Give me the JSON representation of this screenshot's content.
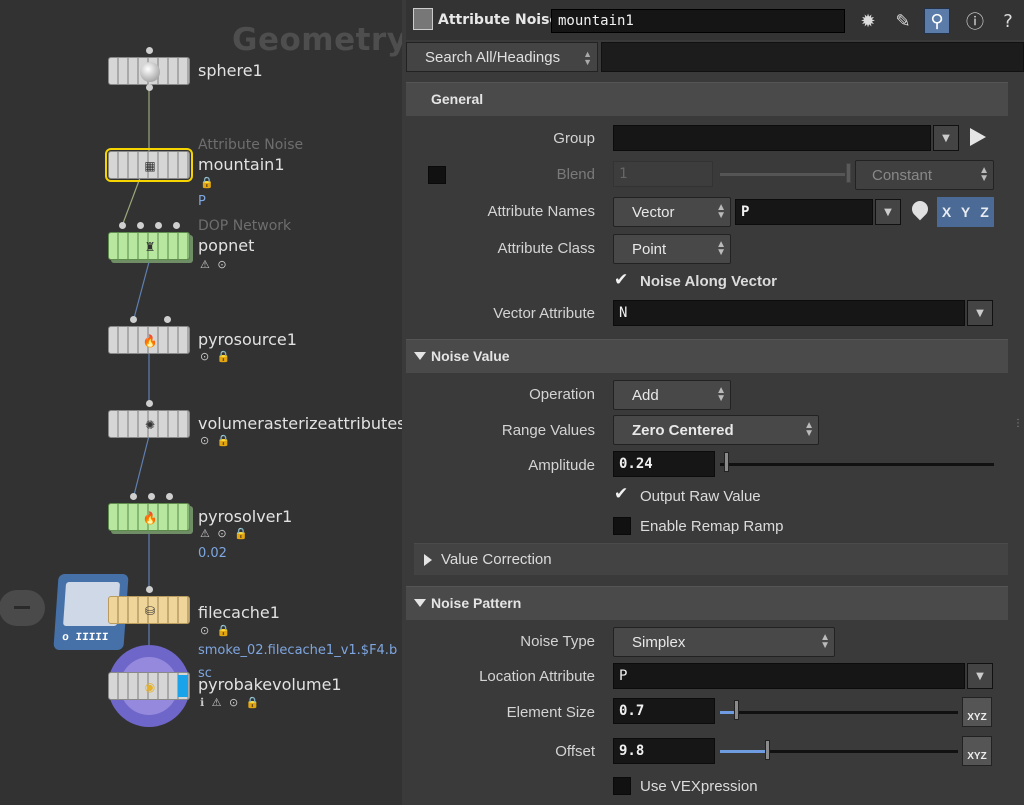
{
  "network": {
    "title": "Geometry",
    "nodes": [
      {
        "name": "sphere1",
        "type": "",
        "sub": "",
        "flags": ""
      },
      {
        "name": "mountain1",
        "type": "Attribute Noise",
        "sub": "P",
        "flags": "🔒"
      },
      {
        "name": "popnet",
        "type": "DOP Network",
        "sub": "",
        "flags": "⚠ ⊙"
      },
      {
        "name": "pyrosource1",
        "type": "",
        "sub": "",
        "flags": "⊙ 🔒"
      },
      {
        "name": "volumerasterizeattributes",
        "type": "",
        "sub": "",
        "flags": "⊙ 🔒"
      },
      {
        "name": "pyrosolver1",
        "type": "",
        "sub": "0.02",
        "flags": "⚠ ⊙ 🔒"
      },
      {
        "name": "filecache1",
        "type": "",
        "sub": "smoke_02.filecache1_v1.$F4.b",
        "flags": "⊙ 🔒"
      },
      {
        "name": "pyrobakevolume1",
        "type": "",
        "sub": "sc",
        "flags": "ℹ ⚠ ⊙ 🔒"
      }
    ]
  },
  "header": {
    "node_type": "Attribute Noise",
    "node_name": "mountain1",
    "icons": [
      "gear-icon",
      "brush-icon",
      "search-icon",
      "info-icon",
      "help-icon"
    ]
  },
  "search": {
    "label": "Search All/Headings"
  },
  "general": {
    "heading": "General",
    "group_label": "Group",
    "group_value": "",
    "blend_label": "Blend",
    "blend_value": "1",
    "blend_mode": "Constant",
    "attr_names_label": "Attribute Names",
    "attr_names_type": "Vector",
    "attr_names_value": "P",
    "xyz": [
      "X",
      "Y",
      "Z"
    ],
    "attr_class_label": "Attribute Class",
    "attr_class_value": "Point",
    "noise_along_vector": "Noise Along Vector",
    "vector_attr_label": "Vector Attribute",
    "vector_attr_value": "N"
  },
  "noise_value": {
    "heading": "Noise Value",
    "operation_label": "Operation",
    "operation_value": "Add",
    "range_label": "Range Values",
    "range_value": "Zero Centered",
    "amplitude_label": "Amplitude",
    "amplitude_value": "0.24",
    "output_raw": "Output Raw Value",
    "enable_remap": "Enable Remap Ramp",
    "value_correction": "Value Correction"
  },
  "noise_pattern": {
    "heading": "Noise Pattern",
    "noise_type_label": "Noise Type",
    "noise_type_value": "Simplex",
    "location_label": "Location Attribute",
    "location_value": "P",
    "element_size_label": "Element Size",
    "element_size_value": "0.7",
    "offset_label": "Offset",
    "offset_value": "9.8",
    "use_vex": "Use VEXpression",
    "xyz_button": "XYZ"
  }
}
